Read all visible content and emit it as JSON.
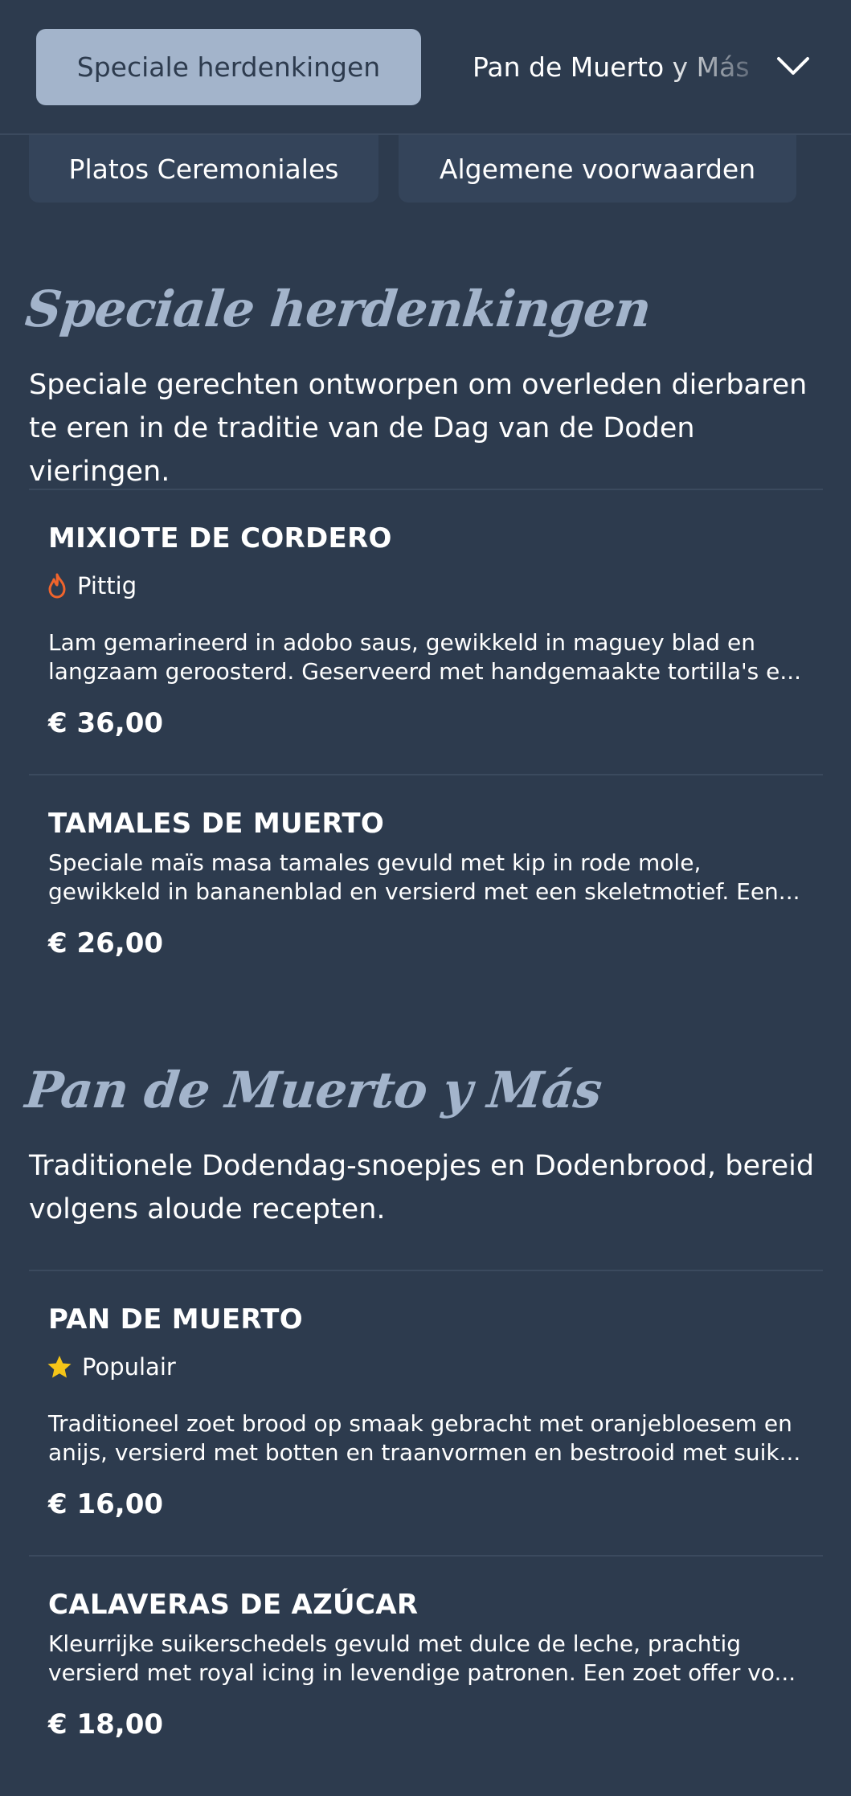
{
  "nav": {
    "active_tab": "Speciale herdenkingen",
    "next_tab": "Pan de Muerto y Más",
    "row2": [
      "Platos Ceremoniales",
      "Algemene voorwaarden"
    ]
  },
  "sections": [
    {
      "title": "Speciale herdenkingen",
      "description": "Speciale gerechten ontworpen om overleden dierbaren te eren in de traditie van de Dag van de Doden vieringen.",
      "items": [
        {
          "name": "MIXIOTE DE CORDERO",
          "tag": "Pittig",
          "tag_icon": "flame-icon",
          "desc_line1": "Lam gemarineerd in adobo saus, gewikkeld in maguey blad en",
          "desc_line2": "langzaam geroosterd. Geserveerd met handgemaakte tortilla's e...",
          "price": "€ 36,00"
        },
        {
          "name": "TAMALES DE MUERTO",
          "desc_line1": "Speciale maïs masa tamales gevuld met kip in rode mole,",
          "desc_line2": "gewikkeld in bananenblad en versierd met een skeletmotief. Een...",
          "price": "€ 26,00"
        }
      ]
    },
    {
      "title": "Pan de Muerto y Más",
      "description": "Traditionele Dodendag-snoepjes en Dodenbrood, bereid volgens aloude recepten.",
      "items": [
        {
          "name": "PAN DE MUERTO",
          "tag": "Populair",
          "tag_icon": "star-icon",
          "desc_line1": "Traditioneel zoet brood op smaak gebracht met oranjebloesem en",
          "desc_line2": "anijs, versierd met botten en traanvormen en bestrooid met suik...",
          "price": "€ 16,00"
        },
        {
          "name": "CALAVERAS DE AZÚCAR",
          "desc_line1": "Kleurrijke suikerschedels gevuld met dulce de leche, prachtig",
          "desc_line2": "versierd met royal icing in levendige patronen. Een zoet offer vo...",
          "price": "€ 18,00"
        }
      ]
    }
  ],
  "colors": {
    "background": "#2d3b4e",
    "accent": "#a3b4cb",
    "flame": "#f0642c",
    "star": "#f5c518"
  }
}
